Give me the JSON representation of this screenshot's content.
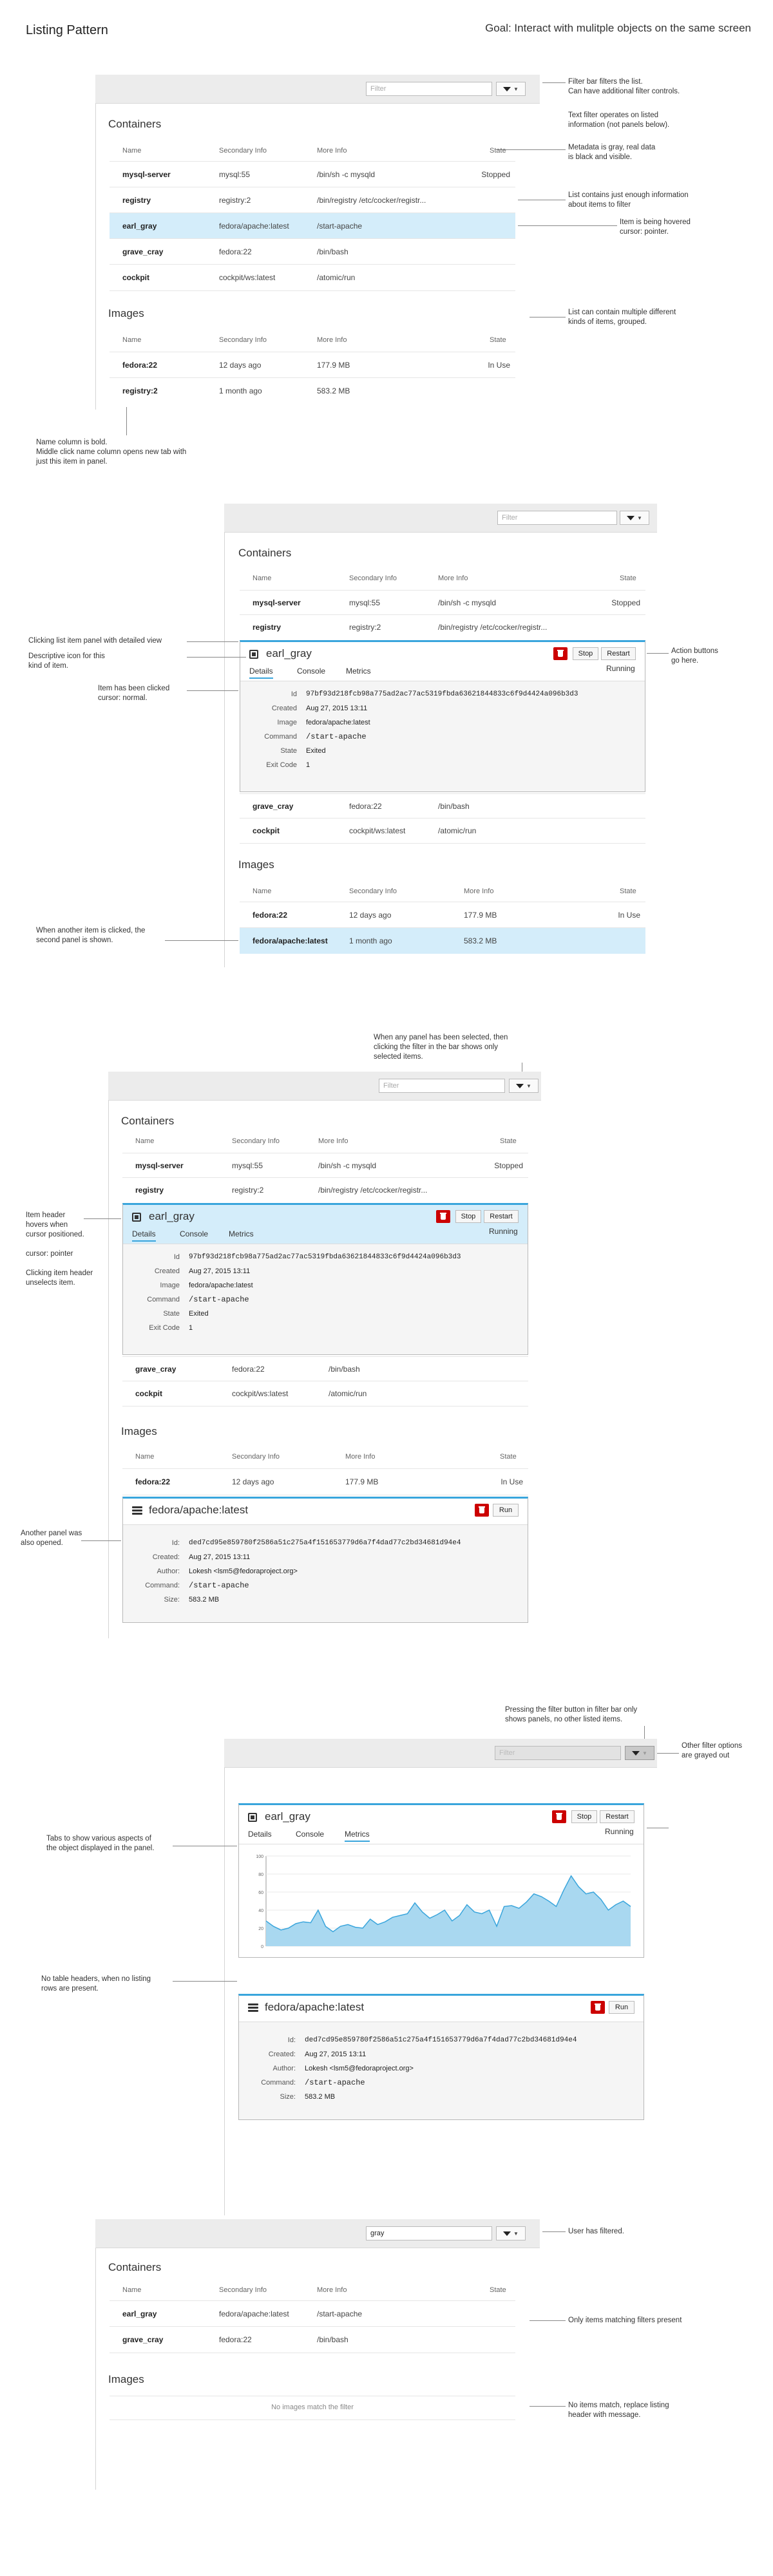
{
  "page_title": "Listing Pattern",
  "goal": "Goal: Interact with mulitple objects on the same screen",
  "filter_placeholder": "Filter",
  "filter_value": "gray",
  "colors": {
    "accent": "#39a5dc",
    "hover": "#d4edfa",
    "delete": "#cc0000",
    "filterbar": "#ececec"
  },
  "headers": {
    "containers": "Containers",
    "images": "Images"
  },
  "columns": {
    "name": "Name",
    "secondary": "Secondary Info",
    "more": "More Info",
    "state": "State"
  },
  "containers": [
    {
      "name": "mysql-server",
      "secondary": "mysql:55",
      "more": "/bin/sh -c mysqld",
      "state": "Stopped"
    },
    {
      "name": "registry",
      "secondary": "registry:2",
      "more": "/bin/registry /etc/cocker/registr...",
      "state": ""
    },
    {
      "name": "earl_gray",
      "secondary": "fedora/apache:latest",
      "more": "/start-apache",
      "state": ""
    },
    {
      "name": "grave_cray",
      "secondary": "fedora:22",
      "more": "/bin/bash",
      "state": ""
    },
    {
      "name": "cockpit",
      "secondary": "cockpit/ws:latest",
      "more": "/atomic/run",
      "state": ""
    }
  ],
  "images": [
    {
      "name": "fedora:22",
      "secondary": "12 days ago",
      "more": "177.9 MB",
      "state": "In Use"
    },
    {
      "name": "registry:2",
      "secondary": "1 month ago",
      "more": "583.2 MB",
      "state": ""
    },
    {
      "name": "fedora/apache:latest",
      "secondary": "1 month ago",
      "more": "583.2 MB",
      "state": ""
    }
  ],
  "container_panel": {
    "title": "earl_gray",
    "tabs": [
      "Details",
      "Console",
      "Metrics"
    ],
    "buttons": {
      "stop": "Stop",
      "restart": "Restart"
    },
    "state": "Running",
    "details": [
      {
        "k": "Id",
        "v": "97bf93d218fcb98a775ad2ac77ac5319fbda63621844833c6f9d4424a096b3d3"
      },
      {
        "k": "Created",
        "v": "Aug 27, 2015 13:11"
      },
      {
        "k": "Image",
        "v": "fedora/apache:latest"
      },
      {
        "k": "Command",
        "v": "/start-apache"
      },
      {
        "k": "State",
        "v": "Exited"
      },
      {
        "k": "Exit Code",
        "v": "1"
      }
    ]
  },
  "image_panel": {
    "title": "fedora/apache:latest",
    "buttons": {
      "run": "Run"
    },
    "details": [
      {
        "k": "Id:",
        "v": "ded7cd95e859780f2586a51c275a4f151653779d6a7f4dad77c2bd34681d94e4"
      },
      {
        "k": "Created:",
        "v": "Aug 27, 2015 13:11"
      },
      {
        "k": "Author:",
        "v": "Lokesh <lsm5@fedoraproject.org>"
      },
      {
        "k": "Command:",
        "v": "/start-apache"
      },
      {
        "k": "Size:",
        "v": "583.2 MB"
      }
    ]
  },
  "chart_data": {
    "type": "area",
    "x": [
      0,
      1,
      2,
      3,
      4,
      5,
      6,
      7,
      8,
      9,
      10,
      11,
      12,
      13,
      14,
      15,
      16,
      17,
      18,
      19,
      20,
      21,
      22,
      23,
      24,
      25,
      26,
      27,
      28,
      29,
      30,
      31,
      32,
      33,
      34,
      35,
      36,
      37,
      38,
      39,
      40,
      41,
      42,
      43,
      44,
      45,
      46,
      47,
      48,
      49
    ],
    "values": [
      28,
      22,
      18,
      20,
      25,
      27,
      26,
      40,
      22,
      16,
      22,
      24,
      21,
      20,
      30,
      24,
      27,
      32,
      34,
      36,
      48,
      38,
      31,
      35,
      40,
      28,
      34,
      46,
      38,
      36,
      40,
      22,
      44,
      45,
      42,
      49,
      58,
      55,
      50,
      44,
      62,
      78,
      66,
      58,
      60,
      52,
      40,
      46,
      50,
      44
    ],
    "ylabel": "",
    "yticks": [
      "100",
      "80",
      "60",
      "40",
      "20",
      "0"
    ],
    "ylim": [
      0,
      100
    ]
  },
  "no_images_msg": "No images match the filter",
  "notes": {
    "n1": "Filter bar filters the list.\nCan have additional filter controls.",
    "n2": "Text filter operates on listed\ninformation (not panels below).",
    "n3": "Metadata is gray, real data\nis black and visible.",
    "n4": "List contains just enough information\nabout items to filter",
    "n5": "Item is being hovered\ncursor: pointer.",
    "n6": "List can contain multiple different\nkinds of items, grouped.",
    "n7": "Name column is bold.\nMiddle click name column opens new tab with\njust this item in panel.",
    "n8": "Clicking list item panel with detailed view",
    "n9": "Descriptive icon for this\nkind of item.",
    "n10": "Item has been clicked\ncursor: normal.",
    "n11": "Action buttons\ngo here.",
    "n12": "When another item is clicked, the\nsecond panel is shown.",
    "n13": "When any panel has been selected, then\nclicking the filter in the bar shows only\nselected items.",
    "n14": "Item header\nhovers when\ncursor positioned.\n\ncursor: pointer\n\nClicking item header\nunselects item.",
    "n15": "Another panel was\nalso opened.",
    "n16": "Pressing the filter button in filter bar only\nshows panels, no other listed items.",
    "n17": "Other filter options\nare grayed out",
    "n18": "Tabs to show various aspects of\nthe object displayed in the panel.",
    "n19": "No table headers, when no listing\nrows are present.",
    "n20": "User has filtered.",
    "n21": "Only items matching filters present",
    "n22": "No items match, replace listing\nheader with message."
  }
}
